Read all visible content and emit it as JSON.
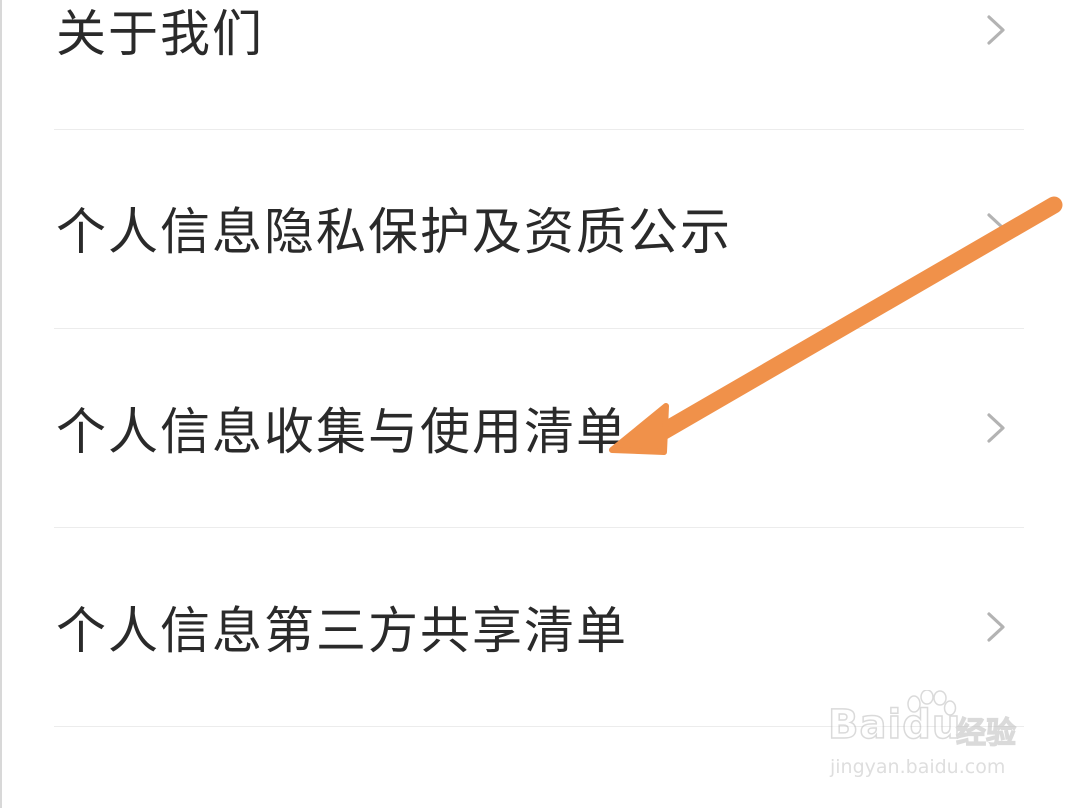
{
  "menu": {
    "items": [
      {
        "label": "关于我们",
        "icon": "chevron-right-icon"
      },
      {
        "label": "个人信息隐私保护及资质公示",
        "icon": "chevron-right-icon"
      },
      {
        "label": "个人信息收集与使用清单",
        "icon": "chevron-right-icon"
      },
      {
        "label": "个人信息第三方共享清单",
        "icon": "chevron-right-icon"
      },
      {
        "label": "",
        "icon": "chevron-right-icon"
      }
    ]
  },
  "annotation": {
    "arrow_color": "#f0914a",
    "points_to": "个人信息收集与使用清单"
  },
  "watermark": {
    "brand": "Baidu",
    "brand_cn": "经验",
    "url": "jingyan.baidu.com"
  },
  "colors": {
    "text": "#2a2a2a",
    "chevron": "#b3b3b3",
    "divider": "#ececec",
    "background": "#ffffff"
  }
}
